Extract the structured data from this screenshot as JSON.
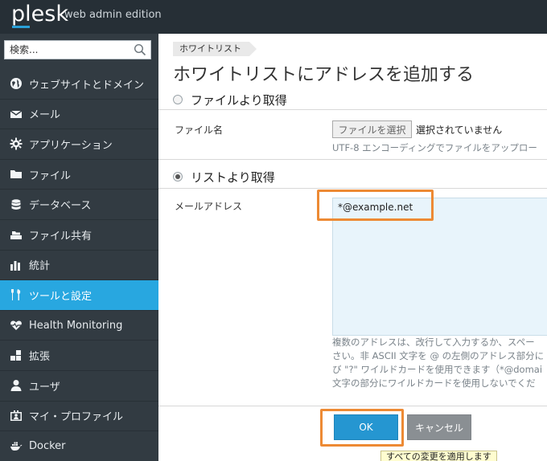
{
  "header": {
    "logo": "plesk",
    "edition": "web admin edition"
  },
  "sidebar": {
    "search": {
      "placeholder": "検索..."
    },
    "items": [
      {
        "label": "ウェブサイトとドメイン",
        "icon": "globe-icon"
      },
      {
        "label": "メール",
        "icon": "envelope-icon"
      },
      {
        "label": "アプリケーション",
        "icon": "gear-icon"
      },
      {
        "label": "ファイル",
        "icon": "folder-icon"
      },
      {
        "label": "データベース",
        "icon": "database-icon"
      },
      {
        "label": "ファイル共有",
        "icon": "file-share-icon"
      },
      {
        "label": "統計",
        "icon": "bar-chart-icon"
      },
      {
        "label": "ツールと設定",
        "icon": "tools-icon",
        "active": true
      },
      {
        "label": "Health Monitoring",
        "icon": "heart-pulse-icon"
      },
      {
        "label": "拡張",
        "icon": "extensions-icon"
      },
      {
        "label": "ユーザ",
        "icon": "user-icon"
      },
      {
        "label": "マイ・プロファイル",
        "icon": "profile-card-icon"
      },
      {
        "label": "Docker",
        "icon": "docker-icon"
      }
    ]
  },
  "main": {
    "breadcrumb": "ホワイトリスト",
    "title": "ホワイトリストにアドレスを追加する",
    "from_file": {
      "label": "ファイルより取得",
      "checked": false,
      "file_name_label": "ファイル名",
      "choose_button": "ファイルを選択",
      "status": "選択されていません",
      "hint": "UTF-8 エンコーディングでファイルをアップロー"
    },
    "from_list": {
      "label": "リストより取得",
      "checked": true,
      "email_label": "メールアドレス",
      "value": "*@example.net",
      "description": [
        "複数のアドレスは、改行して入力するか、スペー",
        "さい。非 ASCII 文字を @ の左側のアドレス部分に",
        "び \"?\" ワイルドカードを使用できます（*@domai",
        "文字の部分にワイルドカードを使用しないでくだ"
      ]
    },
    "buttons": {
      "ok": "OK",
      "cancel": "キャンセル",
      "tooltip": "すべての変更を適用します"
    }
  },
  "colors": {
    "topbar": "#262f36",
    "sidebar": "#323b42",
    "active_item": "#28a7e0",
    "ok_button": "#2596d1",
    "cancel_button": "#8a8f93",
    "highlight": "#ed8a34"
  }
}
